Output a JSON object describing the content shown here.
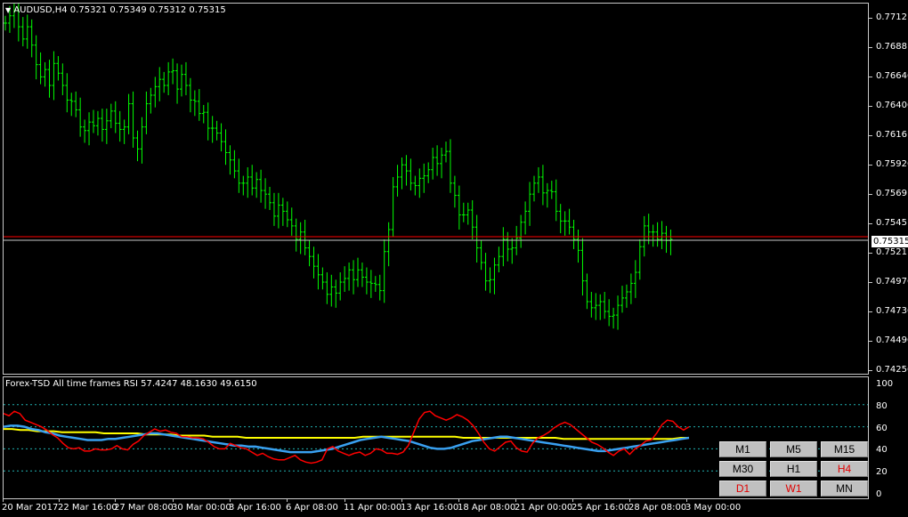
{
  "header": {
    "symbol_info": "AUDUSD,H4  0.75321 0.75349 0.75312 0.75315",
    "arrow": "▼"
  },
  "price_axis": [
    "0.77121",
    "0.76881",
    "0.76646",
    "0.76406",
    "0.76161",
    "0.75926",
    "0.75691",
    "0.75451",
    "0.75211",
    "0.74976",
    "0.74736",
    "0.74496",
    "0.74256"
  ],
  "current_price": "0.75315",
  "indicator": {
    "title": "Forex-TSD All time frames RSI 57.4247 48.1630 49.6150",
    "levels": [
      "100",
      "80",
      "60",
      "40",
      "20",
      "0"
    ]
  },
  "time_axis": [
    "20 Mar 2017",
    "22 Mar 16:00",
    "27 Mar 08:00",
    "30 Mar 00:00",
    "3 Apr 16:00",
    "6 Apr 08:00",
    "11 Apr 00:00",
    "13 Apr 16:00",
    "18 Apr 08:00",
    "21 Apr 00:00",
    "25 Apr 16:00",
    "28 Apr 08:00",
    "3 May 00:00"
  ],
  "timeframes": [
    {
      "label": "M1",
      "active": false
    },
    {
      "label": "M5",
      "active": false
    },
    {
      "label": "M15",
      "active": false
    },
    {
      "label": "M30",
      "active": false
    },
    {
      "label": "H1",
      "active": false
    },
    {
      "label": "H4",
      "active": true
    },
    {
      "label": "D1",
      "active": true
    },
    {
      "label": "W1",
      "active": true
    },
    {
      "label": "MN",
      "active": false
    }
  ],
  "colors": {
    "candle": "#00ff00",
    "bid_line": "#c8c8c8",
    "ask_line": "#ff0000",
    "rsi_fast": "#ff0000",
    "rsi_mid": "#39a0f0",
    "rsi_slow": "#ffff00",
    "level_line": "#20b0b0"
  },
  "chart_data": {
    "type": "line",
    "candles_close": [
      0.7706,
      0.7712,
      0.7716,
      0.7703,
      0.7693,
      0.7703,
      0.7688,
      0.7672,
      0.7662,
      0.7668,
      0.7655,
      0.7673,
      0.7665,
      0.7655,
      0.7643,
      0.7642,
      0.7635,
      0.7621,
      0.7618,
      0.7625,
      0.7622,
      0.7628,
      0.7619,
      0.7626,
      0.7634,
      0.7624,
      0.7619,
      0.7621,
      0.764,
      0.7612,
      0.7603,
      0.7621,
      0.764,
      0.7647,
      0.7654,
      0.766,
      0.7655,
      0.7666,
      0.7667,
      0.7652,
      0.7664,
      0.7655,
      0.7643,
      0.7642,
      0.7632,
      0.7633,
      0.762,
      0.762,
      0.7616,
      0.7609,
      0.76,
      0.7594,
      0.7585,
      0.7575,
      0.7575,
      0.758,
      0.7571,
      0.7578,
      0.7569,
      0.7566,
      0.7559,
      0.7548,
      0.7557,
      0.7552,
      0.7545,
      0.754,
      0.7529,
      0.7535,
      0.7522,
      0.7515,
      0.7507,
      0.75,
      0.7494,
      0.7484,
      0.749,
      0.7485,
      0.7494,
      0.7497,
      0.7504,
      0.7496,
      0.7504,
      0.7498,
      0.7494,
      0.7493,
      0.7492,
      0.7487,
      0.7519,
      0.7537,
      0.7572,
      0.758,
      0.759,
      0.7585,
      0.7575,
      0.7573,
      0.7579,
      0.7581,
      0.7586,
      0.7596,
      0.7591,
      0.7598,
      0.7601,
      0.7575,
      0.7565,
      0.7549,
      0.7549,
      0.7553,
      0.7539,
      0.7522,
      0.751,
      0.7495,
      0.7496,
      0.7508,
      0.7515,
      0.7529,
      0.7521,
      0.7522,
      0.753,
      0.7543,
      0.7552,
      0.7566,
      0.7575,
      0.758,
      0.7567,
      0.7569,
      0.7568,
      0.7552,
      0.7544,
      0.7544,
      0.7539,
      0.7529,
      0.752,
      0.7495,
      0.7478,
      0.7473,
      0.7475,
      0.7478,
      0.747,
      0.7466,
      0.7467,
      0.7475,
      0.7481,
      0.7486,
      0.7493,
      0.7502,
      0.7523,
      0.754,
      0.7535,
      0.7535,
      0.7529,
      0.7534,
      0.7528,
      0.7529
    ],
    "rsi_fast": [
      72,
      70,
      74,
      72,
      66,
      64,
      62,
      60,
      57,
      53,
      50,
      45,
      41,
      40,
      41,
      38,
      38,
      40,
      39,
      39,
      40,
      43,
      40,
      39,
      44,
      47,
      52,
      55,
      58,
      56,
      57,
      55,
      54,
      51,
      51,
      50,
      50,
      49,
      46,
      42,
      40,
      40,
      45,
      43,
      41,
      40,
      37,
      34,
      36,
      33,
      31,
      30,
      30,
      32,
      34,
      30,
      28,
      27,
      28,
      30,
      40,
      42,
      38,
      36,
      34,
      36,
      37,
      34,
      36,
      40,
      39,
      36,
      36,
      35,
      37,
      43,
      55,
      67,
      73,
      74,
      70,
      68,
      66,
      68,
      71,
      69,
      66,
      61,
      54,
      46,
      40,
      38,
      42,
      46,
      47,
      41,
      38,
      37,
      45,
      50,
      52,
      55,
      59,
      62,
      64,
      62,
      58,
      54,
      50,
      46,
      44,
      41,
      37,
      34,
      38,
      40,
      35,
      40,
      43,
      47,
      48,
      54,
      62,
      66,
      65,
      60,
      57,
      60
    ],
    "rsi_mid": [
      60,
      61,
      61,
      60,
      58,
      57,
      55,
      54,
      52,
      51,
      50,
      49,
      48,
      48,
      48,
      49,
      49,
      50,
      51,
      52,
      53,
      54,
      54,
      53,
      52,
      51,
      50,
      49,
      48,
      47,
      46,
      45,
      44,
      43,
      43,
      42,
      42,
      41,
      40,
      39,
      38,
      37,
      37,
      37,
      37,
      38,
      39,
      40,
      42,
      44,
      46,
      48,
      49,
      50,
      51,
      50,
      49,
      48,
      47,
      45,
      43,
      41,
      40,
      40,
      41,
      43,
      45,
      47,
      48,
      49,
      50,
      51,
      51,
      50,
      49,
      48,
      47,
      46,
      45,
      44,
      43,
      42,
      41,
      40,
      39,
      38,
      38,
      39,
      40,
      41,
      42,
      43,
      44,
      45,
      46,
      47,
      48,
      49,
      50
    ],
    "rsi_slow": [
      58,
      58,
      57,
      57,
      56,
      56,
      56,
      55,
      55,
      55,
      55,
      55,
      54,
      54,
      54,
      54,
      54,
      53,
      53,
      53,
      53,
      52,
      52,
      52,
      52,
      51,
      51,
      51,
      51,
      50,
      50,
      50,
      50,
      50,
      50,
      50,
      50,
      50,
      50,
      50,
      50,
      50,
      50,
      51,
      51,
      51,
      51,
      51,
      51,
      51,
      51,
      51,
      51,
      51,
      51,
      50,
      50,
      50,
      50,
      50,
      50,
      50,
      50,
      50,
      50,
      50,
      50,
      49,
      49,
      49,
      49,
      49,
      49,
      49,
      49,
      49,
      49,
      49,
      49,
      49,
      49,
      50,
      50
    ]
  }
}
